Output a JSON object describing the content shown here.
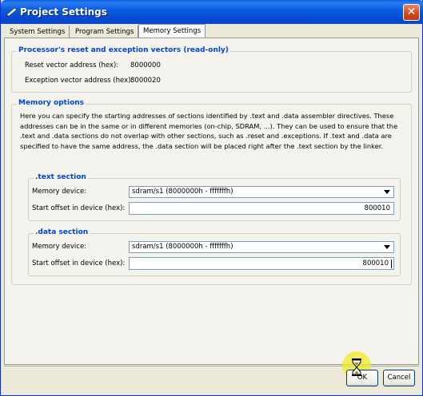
{
  "window": {
    "title": "Project Settings",
    "close_glyph": "✕"
  },
  "tabs": [
    {
      "label": "System Settings"
    },
    {
      "label": "Program Settings"
    },
    {
      "label": "Memory Settings",
      "active": true
    }
  ],
  "vectors": {
    "title": "Processor's reset and exception vectors (read-only)",
    "reset_label": "Reset vector address (hex):",
    "reset_value": "8000000",
    "exception_label": "Exception vector address (hex):",
    "exception_value": "8000020"
  },
  "memory_options": {
    "title": "Memory options",
    "description": "Here you can specify the starting addresses of sections identified by .text and .data assembler directives. These addresses can be in the same or in different memories (on-chip, SDRAM, ...). They can be used to ensure that the .text and .data sections do not overlap with other sections, such as .reset and .exceptions. If .text and .data are specified to have the same address, the .data section will be placed right after the .text section by the linker.",
    "text_section": {
      "title": ".text section",
      "device_label": "Memory device:",
      "device_value": "sdram/s1 (8000000h - fffffffh)",
      "offset_label": "Start offset in device (hex):",
      "offset_value": "800010"
    },
    "data_section": {
      "title": ".data section",
      "device_label": "Memory device:",
      "device_value": "sdram/s1 (8000000h - fffffffh)",
      "offset_label": "Start offset in device (hex):",
      "offset_value": "800010"
    }
  },
  "buttons": {
    "ok": "OK",
    "cancel": "Cancel"
  },
  "colors": {
    "title_bar": "#0a5be0",
    "group_title": "#0046d5",
    "cursor_highlight": "#f0eb28"
  },
  "icons": {
    "app": "pen-icon",
    "busy_cursor": "hourglass-icon"
  }
}
